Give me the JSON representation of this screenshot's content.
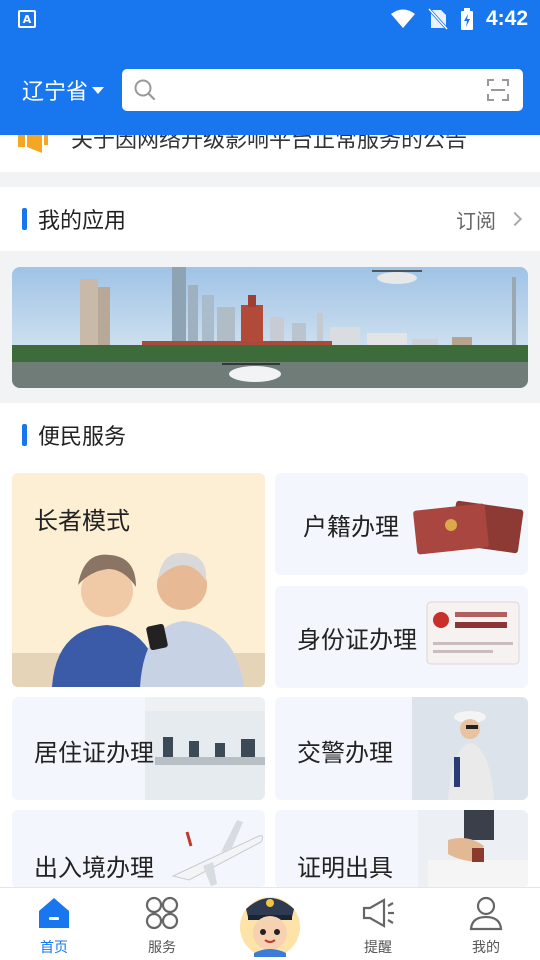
{
  "status_bar": {
    "time": "4:42",
    "app_icon": "A"
  },
  "header": {
    "province": "辽宁省",
    "search_placeholder": ""
  },
  "notice": {
    "text": "关于因网络升级影响平台正常服务的公告"
  },
  "my_apps": {
    "title": "我的应用",
    "subscribe": "订阅"
  },
  "services": {
    "title": "便民服务",
    "items": [
      {
        "label": "长者模式"
      },
      {
        "label": "户籍办理"
      },
      {
        "label": "身份证办理"
      },
      {
        "label": "居住证办理"
      },
      {
        "label": "交警办理"
      },
      {
        "label": "出入境办理"
      },
      {
        "label": "证明出具"
      }
    ]
  },
  "tabbar": {
    "items": [
      {
        "label": "首页",
        "icon": "home-icon",
        "active": true
      },
      {
        "label": "服务",
        "icon": "grid-icon"
      },
      {
        "label": "",
        "icon": "police-mascot-icon"
      },
      {
        "label": "提醒",
        "icon": "megaphone-icon"
      },
      {
        "label": "我的",
        "icon": "user-icon"
      }
    ]
  },
  "colors": {
    "primary": "#1877ee",
    "card_bg": "#f3f7fd",
    "elder_bg": "#fdefd4"
  }
}
